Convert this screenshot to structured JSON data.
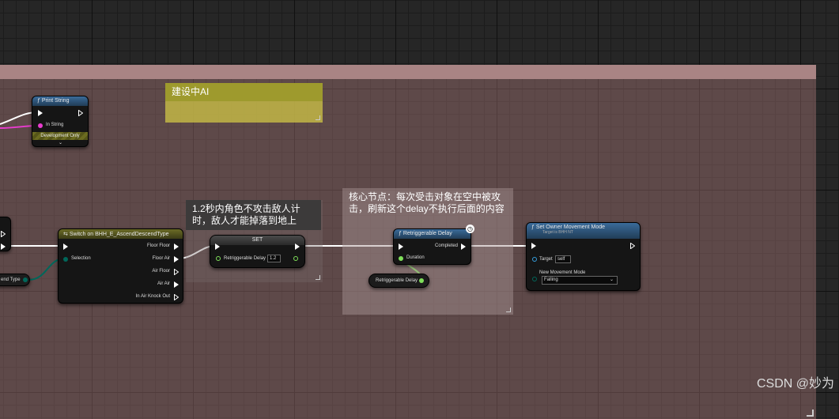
{
  "comments": {
    "ai": "建设中AI",
    "set": "1.2秒内角色不攻击敌人计时，敌人才能掉落到地上",
    "core": "核心节点：每次受击对象在空中被攻击，刷新这个delay不执行后面的内容"
  },
  "print_string": {
    "title": "Print String",
    "in_string": "In String",
    "dev_only": "Development Only"
  },
  "left_stub": {
    "label": "end Type"
  },
  "switch_node": {
    "title": "Switch on BHH_E_AscendDescendType",
    "selection": "Selection",
    "outputs": [
      "Floor Floor",
      "Floor Air",
      "Air Floor",
      "Air Air",
      "In Air Knock Out"
    ]
  },
  "set_node": {
    "title": "SET",
    "var": "Retriggerable Delay",
    "value": "1.2"
  },
  "delay_node": {
    "title": "Retriggerable Delay",
    "completed": "Completed",
    "duration": "Duration"
  },
  "var_get": {
    "label": "Retriggerable Delay"
  },
  "movement_node": {
    "title": "Set Owner Movement Mode",
    "subtitle": "Target is BHH NT",
    "target": "Target",
    "target_value": "self",
    "mode_label": "New Movement Mode",
    "mode_value": "Falling"
  },
  "watermark": "CSDN @妙为",
  "colors": {
    "exec": "#ffffff",
    "float": "#7fe05a",
    "string": "#e93ccf",
    "enum": "#00675a",
    "object": "#35a0e0"
  }
}
